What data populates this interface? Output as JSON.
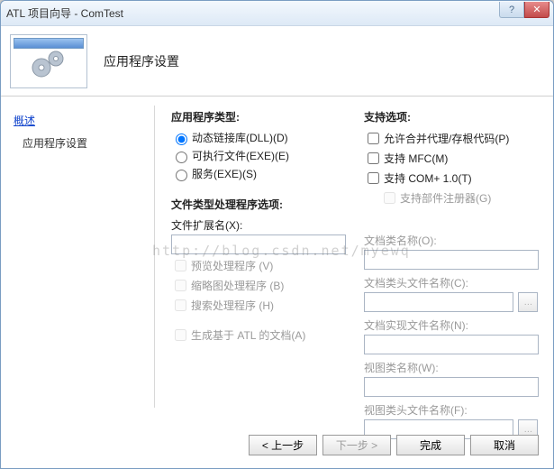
{
  "window": {
    "title": "ATL 项目向导 - ComTest"
  },
  "header": {
    "title": "应用程序设置"
  },
  "sidebar": {
    "overview": "概述",
    "app_settings": "应用程序设置"
  },
  "app_type": {
    "title": "应用程序类型:",
    "dll": "动态链接库(DLL)(D)",
    "exe": "可执行文件(EXE)(E)",
    "service": "服务(EXE)(S)",
    "selected": "dll"
  },
  "file_type": {
    "title": "文件类型处理程序选项:",
    "ext_label": "文件扩展名(X):",
    "ext_value": "",
    "preview": "预览处理程序 (V)",
    "thumb": "缩略图处理程序 (B)",
    "search": "搜索处理程序 (H)",
    "gen_atl_doc": "生成基于 ATL 的文档(A)"
  },
  "support": {
    "title": "支持选项:",
    "merge_proxy": "允许合并代理/存根代码(P)",
    "mfc": "支持 MFC(M)",
    "complus": "支持 COM+ 1.0(T)",
    "component_reg": "支持部件注册器(G)"
  },
  "doc_fields": {
    "doc_class": "文档类名称(O):",
    "doc_header": "文档类头文件名称(C):",
    "doc_impl": "文档实现文件名称(N):",
    "view_class": "视图类名称(W):",
    "view_header": "视图类头文件名称(F):"
  },
  "buttons": {
    "prev": "< 上一步",
    "next": "下一步 >",
    "finish": "完成",
    "cancel": "取消"
  },
  "watermark": "http://blog.csdn.net/myewq"
}
